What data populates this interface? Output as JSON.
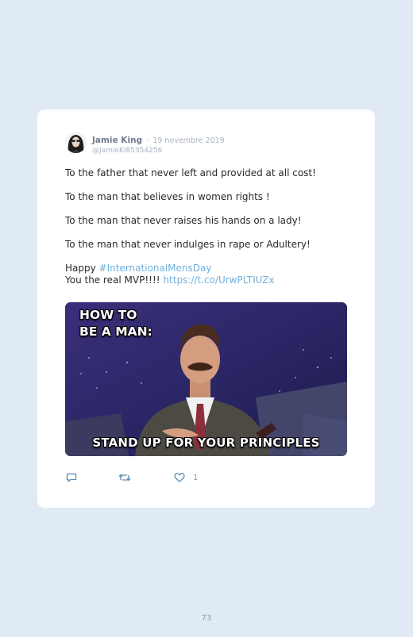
{
  "tweet": {
    "author_name": "Jamie King",
    "separator": "·",
    "date": "19 novembre 2019",
    "handle": "@JamieKi85354256",
    "lines": [
      "To the father that never left and provided at all cost!",
      "To the man that believes in women rights !",
      "To the man that never raises his hands on a lady!",
      "To the man that never indulges in rape or Adultery!"
    ],
    "closing": {
      "happy": "Happy ",
      "hashtag": "#InternationalMensDay",
      "mvp": "You the real MVP!!!! ",
      "url": "https://t.co/UrwPLTIUZx"
    },
    "media": {
      "top_caption_line1": "HOW TO",
      "top_caption_line2": "BE A MAN:",
      "bottom_caption": "STAND UP FOR YOUR PRINCIPLES"
    },
    "actions": {
      "like_count": "1"
    }
  },
  "page": {
    "number": "73"
  },
  "colors": {
    "background": "#dfeaf4",
    "card": "#ffffff",
    "link": "#71b1dd",
    "text": "#26292e",
    "muted": "#a9b3c0"
  },
  "icons": [
    "reply-icon",
    "retweet-icon",
    "heart-icon"
  ]
}
